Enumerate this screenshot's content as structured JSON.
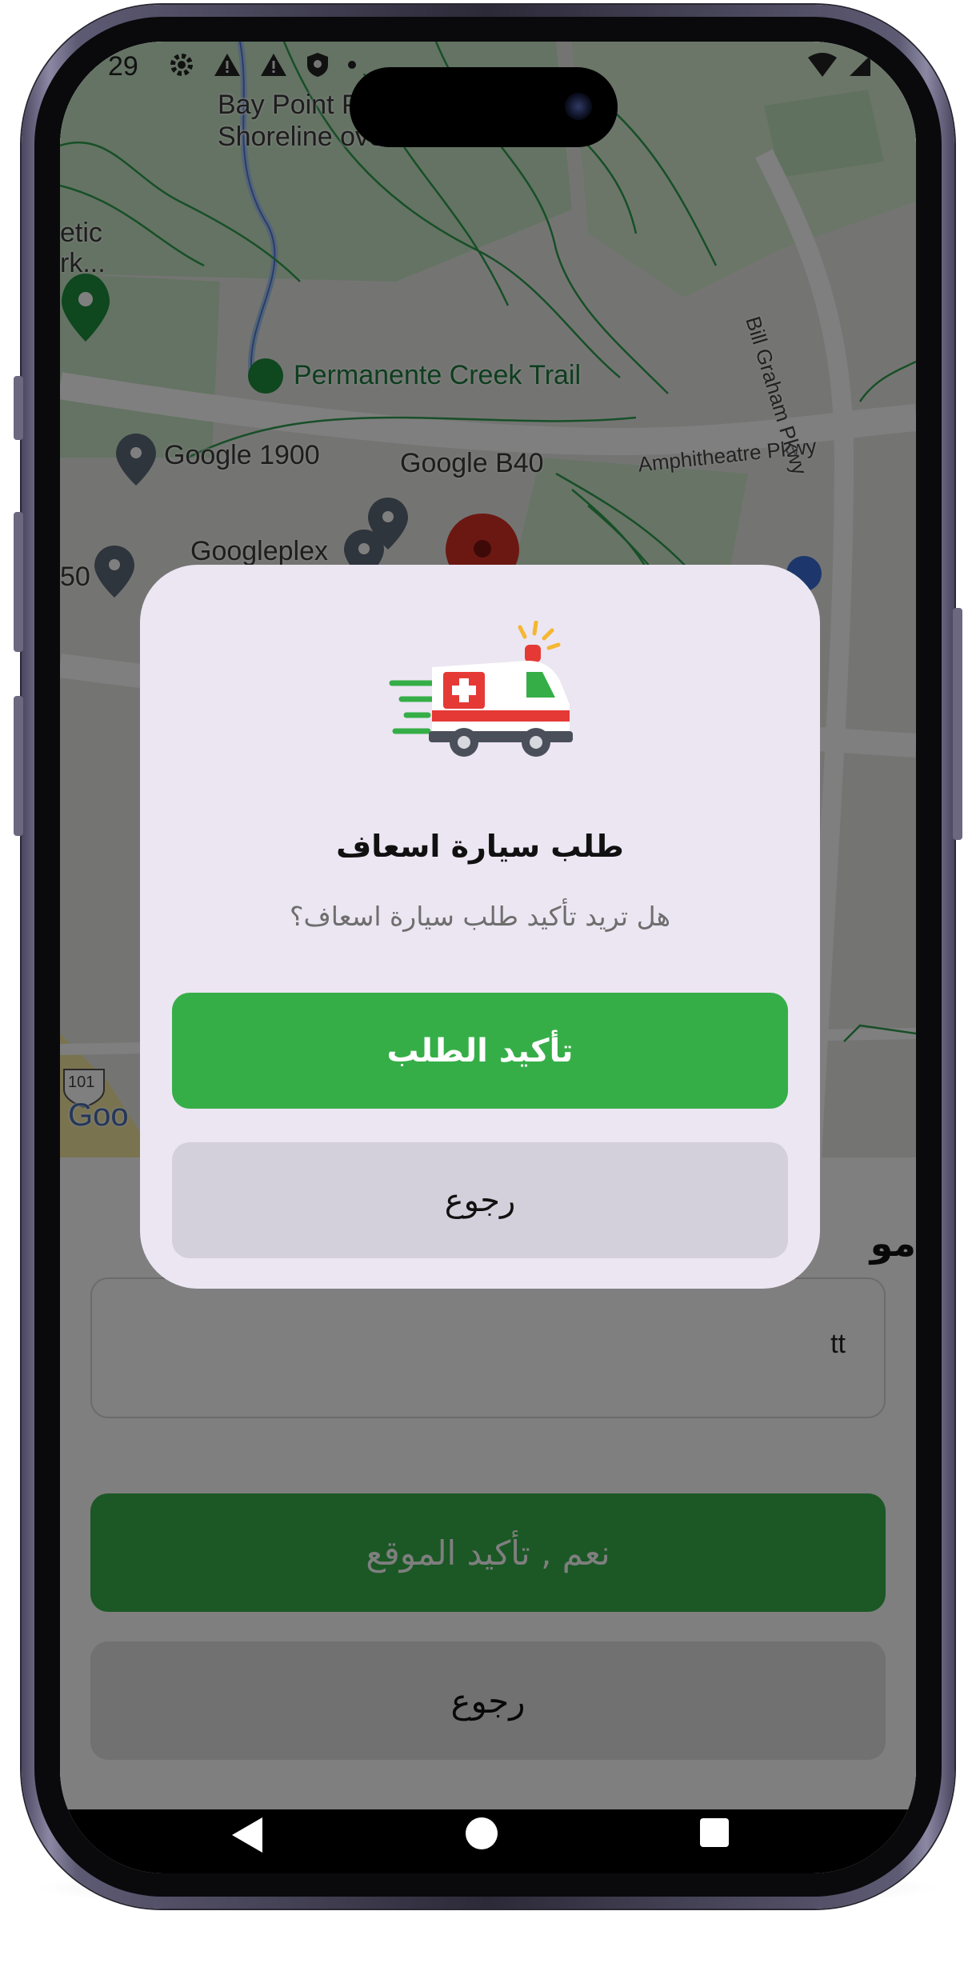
{
  "status_bar": {
    "time": "29",
    "icons": [
      "gear-icon",
      "warning-icon",
      "warning-icon",
      "shield-icon",
      "dot-icon"
    ],
    "right_icons": [
      "wifi-icon",
      "signal-icon"
    ]
  },
  "map": {
    "labels": {
      "bay_point_line1": "Bay Point P",
      "bay_point_line2": "Shoreline overlook",
      "athletic_line1": "etic",
      "athletic_line2": "rk...",
      "permanente": "Permanente Creek Trail",
      "google_1900": "Google 1900",
      "google_b40": "Google B40",
      "amphitheatre": "Amphitheatre Pkwy",
      "bill_graham": "Bill Graham Pkwy",
      "googleplex": "Googleplex",
      "fifty": "50",
      "highway": "101",
      "logo": "Goo"
    },
    "colors": {
      "park": "#c9e7c6",
      "road": "#ffffff",
      "trail": "#2e9e4f",
      "water": "#a9c8f0",
      "pin": "#d93025"
    }
  },
  "sheet": {
    "title": "مو",
    "input_value": "tt",
    "confirm_label": "نعم , تأكيد الموقع",
    "back_label": "رجوع"
  },
  "dialog": {
    "icon": "ambulance-icon",
    "title": "طلب سيارة اسعاف",
    "message": "هل تريد تأكيد طلب سيارة اسعاف؟",
    "confirm_label": "تأكيد الطلب",
    "back_label": "رجوع"
  },
  "navbar": {
    "icons": [
      "back-triangle-icon",
      "home-circle-icon",
      "recents-square-icon"
    ]
  },
  "colors": {
    "primary_green": "#36ae48",
    "dialog_bg": "#ece6f2",
    "secondary_button": "#d4d0db",
    "overlay": "rgba(0,0,0,0.5)"
  }
}
